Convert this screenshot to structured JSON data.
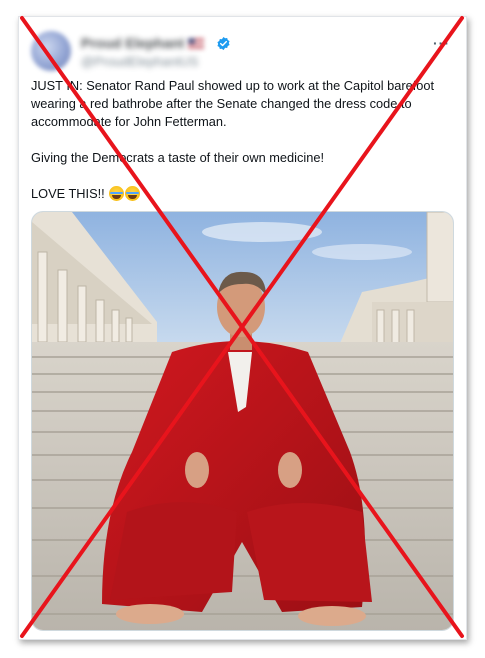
{
  "tweet": {
    "display_name": "Proud Elephant",
    "handle": "@ProudElephantUS",
    "verified_icon": "verified-badge-icon",
    "more_label": "···",
    "lines": [
      "JUST IN: Senator Rand Paul showed up to work at the Capitol barefoot wearing a red bathrobe after the Senate changed the dress code to accommodate for John Fetterman.",
      "Giving the Democrats a taste of their own medicine!",
      "LOVE THIS!!"
    ]
  },
  "colors": {
    "overlay_x": "#e8141c",
    "verified": "#1d9bf0",
    "robe": "#c4161c",
    "sky": "#a7c4e6"
  }
}
